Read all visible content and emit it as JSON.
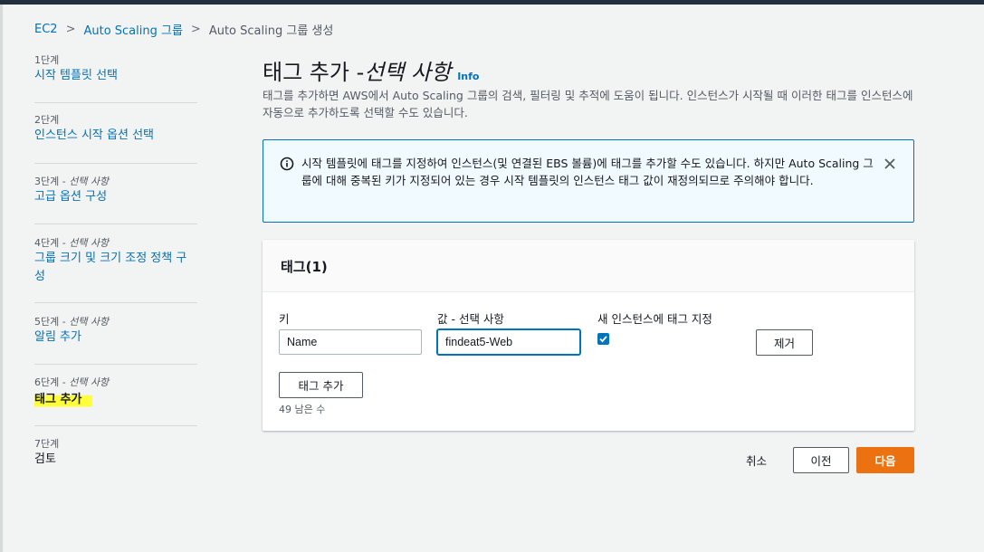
{
  "breadcrumb": {
    "items": [
      "EC2",
      "Auto Scaling 그룹",
      "Auto Scaling 그룹 생성"
    ]
  },
  "steps": [
    {
      "label": "1단계",
      "optional": "",
      "name": "시작 템플릿 선택"
    },
    {
      "label": "2단계",
      "optional": "",
      "name": "인스턴스 시작 옵션 선택"
    },
    {
      "label": "3단계 - ",
      "optional": "선택 사항",
      "name": "고급 옵션 구성"
    },
    {
      "label": "4단계 - ",
      "optional": "선택 사항",
      "name": "그룹 크기 및 크기 조정 정책 구성"
    },
    {
      "label": "5단계 - ",
      "optional": "선택 사항",
      "name": "알림 추가"
    },
    {
      "label": "6단계 - ",
      "optional": "선택 사항",
      "name": "태그 추가"
    },
    {
      "label": "7단계",
      "optional": "",
      "name": "검토"
    }
  ],
  "page": {
    "title_main": "태그 추가 - ",
    "title_optional": "선택 사항",
    "info_link": "Info",
    "description": "태그를 추가하면 AWS에서 Auto Scaling 그룹의 검색, 필터링 및 추적에 도움이 됩니다. 인스턴스가 시작될 때 이러한 태그를 인스턴스에 자동으로 추가하도록 선택할 수도 있습니다."
  },
  "alert": {
    "text": "시작 템플릿에 태그를 지정하여 인스턴스(및 연결된 EBS 볼륨)에 태그를 추가할 수도 있습니다. 하지만 Auto Scaling 그룹에 대해 중복된 키가 지정되어 있는 경우 시작 템플릿의 인스턴스 태그 값이 재정의되므로 주의해야 합니다."
  },
  "tags_panel": {
    "title": "태그(1)",
    "key_label": "키",
    "value_label": "값 - 선택 사항",
    "tag_new_label": "새 인스턴스에 태그 지정",
    "key_value": "Name",
    "value_value": "findeat5-Web",
    "tag_new_checked": true,
    "remove_label": "제거",
    "add_tag_label": "태그 추가",
    "remaining": "49 남은 수"
  },
  "footer": {
    "cancel": "취소",
    "previous": "이전",
    "next": "다음"
  },
  "colors": {
    "link": "#0073bb",
    "primary": "#ec7211",
    "highlight": "#ffff3a",
    "alert_bg": "#f1faff"
  }
}
